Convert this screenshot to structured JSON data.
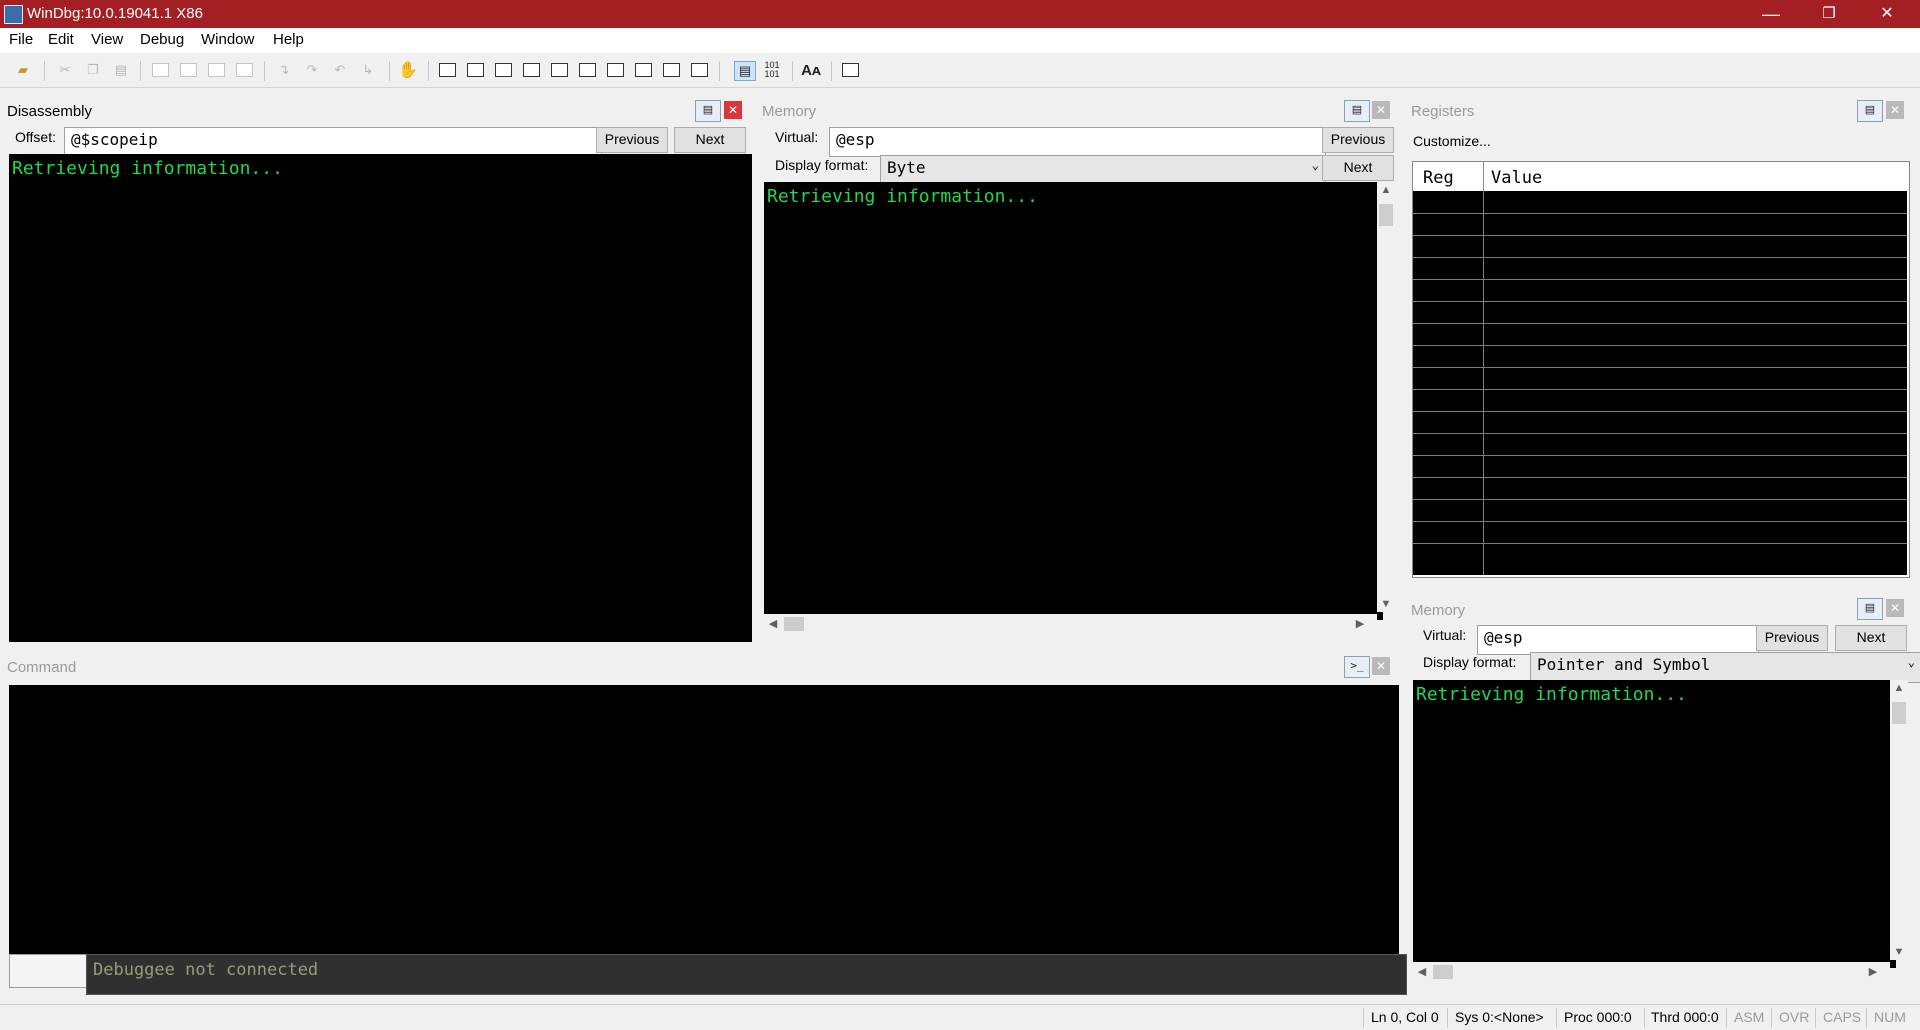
{
  "window": {
    "title": "WinDbg:10.0.19041.1 X86",
    "minimize": "—",
    "restore": "❐",
    "close": "✕"
  },
  "menu": [
    "File",
    "Edit",
    "View",
    "Debug",
    "Window",
    "Help"
  ],
  "disassembly": {
    "title": "Disassembly",
    "offset_label": "Offset:",
    "offset_value": "@$scopeip",
    "previous": "Previous",
    "next": "Next",
    "output": "Retrieving information..."
  },
  "memory1": {
    "title": "Memory",
    "virtual_label": "Virtual:",
    "virtual_value": "@esp",
    "display_format_label": "Display format:",
    "display_format_value": "Byte",
    "previous": "Previous",
    "next": "Next",
    "output": "Retrieving information..."
  },
  "registers": {
    "title": "Registers",
    "customize": "Customize...",
    "columns": [
      "Reg",
      "Value"
    ]
  },
  "memory2": {
    "title": "Memory",
    "virtual_label": "Virtual:",
    "virtual_value": "@esp",
    "display_format_label": "Display format:",
    "display_format_value": "Pointer and Symbol",
    "previous": "Previous",
    "next": "Next",
    "output": "Retrieving information..."
  },
  "command": {
    "title": "Command",
    "status": "Debuggee not connected"
  },
  "statusbar": {
    "position": "Ln 0, Col 0",
    "sys": "Sys 0:<None>",
    "proc": "Proc 000:0",
    "thrd": "Thrd 000:0",
    "asm": "ASM",
    "ovr": "OVR",
    "caps": "CAPS",
    "num": "NUM"
  },
  "colors": {
    "titlebar": "#a31f24",
    "console_bg": "#000000",
    "console_text": "#21d94a",
    "close_active": "#d9363c"
  }
}
